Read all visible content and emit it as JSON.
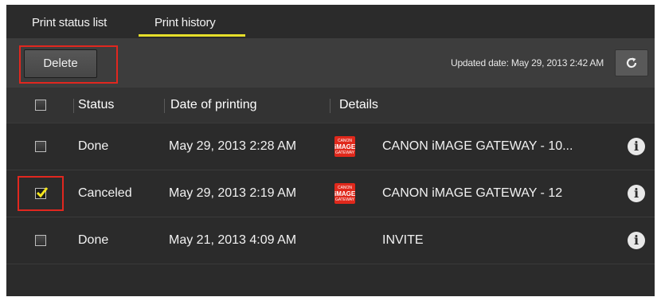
{
  "tabs": [
    {
      "label": "Print status list"
    },
    {
      "label": "Print history"
    }
  ],
  "toolbar": {
    "delete_label": "Delete",
    "updated_text": "Updated date: May 29, 2013 2:42 AM",
    "refresh_icon": "refresh-icon"
  },
  "table": {
    "columns": [
      "Status",
      "Date of printing",
      "Details"
    ],
    "rows": [
      {
        "checked": false,
        "status": "Done",
        "date": "May 29, 2013 2:28 AM",
        "details": "CANON iMAGE GATEWAY - 10...",
        "has_thumb": true
      },
      {
        "checked": true,
        "status": "Canceled",
        "date": "May 29, 2013 2:19 AM",
        "details": "CANON iMAGE GATEWAY - 12",
        "has_thumb": true
      },
      {
        "checked": false,
        "status": "Done",
        "date": "May 21, 2013 4:09 AM",
        "details": "INVITE",
        "has_thumb": false
      }
    ]
  },
  "thumb": {
    "line1": "CANON",
    "line2": "iMAGE",
    "line3": "GATEWAY"
  },
  "colors": {
    "highlight": "#e1271f",
    "tab_underline": "#e6df2a",
    "check": "#f5e61c",
    "thumb": "#e0281b"
  }
}
